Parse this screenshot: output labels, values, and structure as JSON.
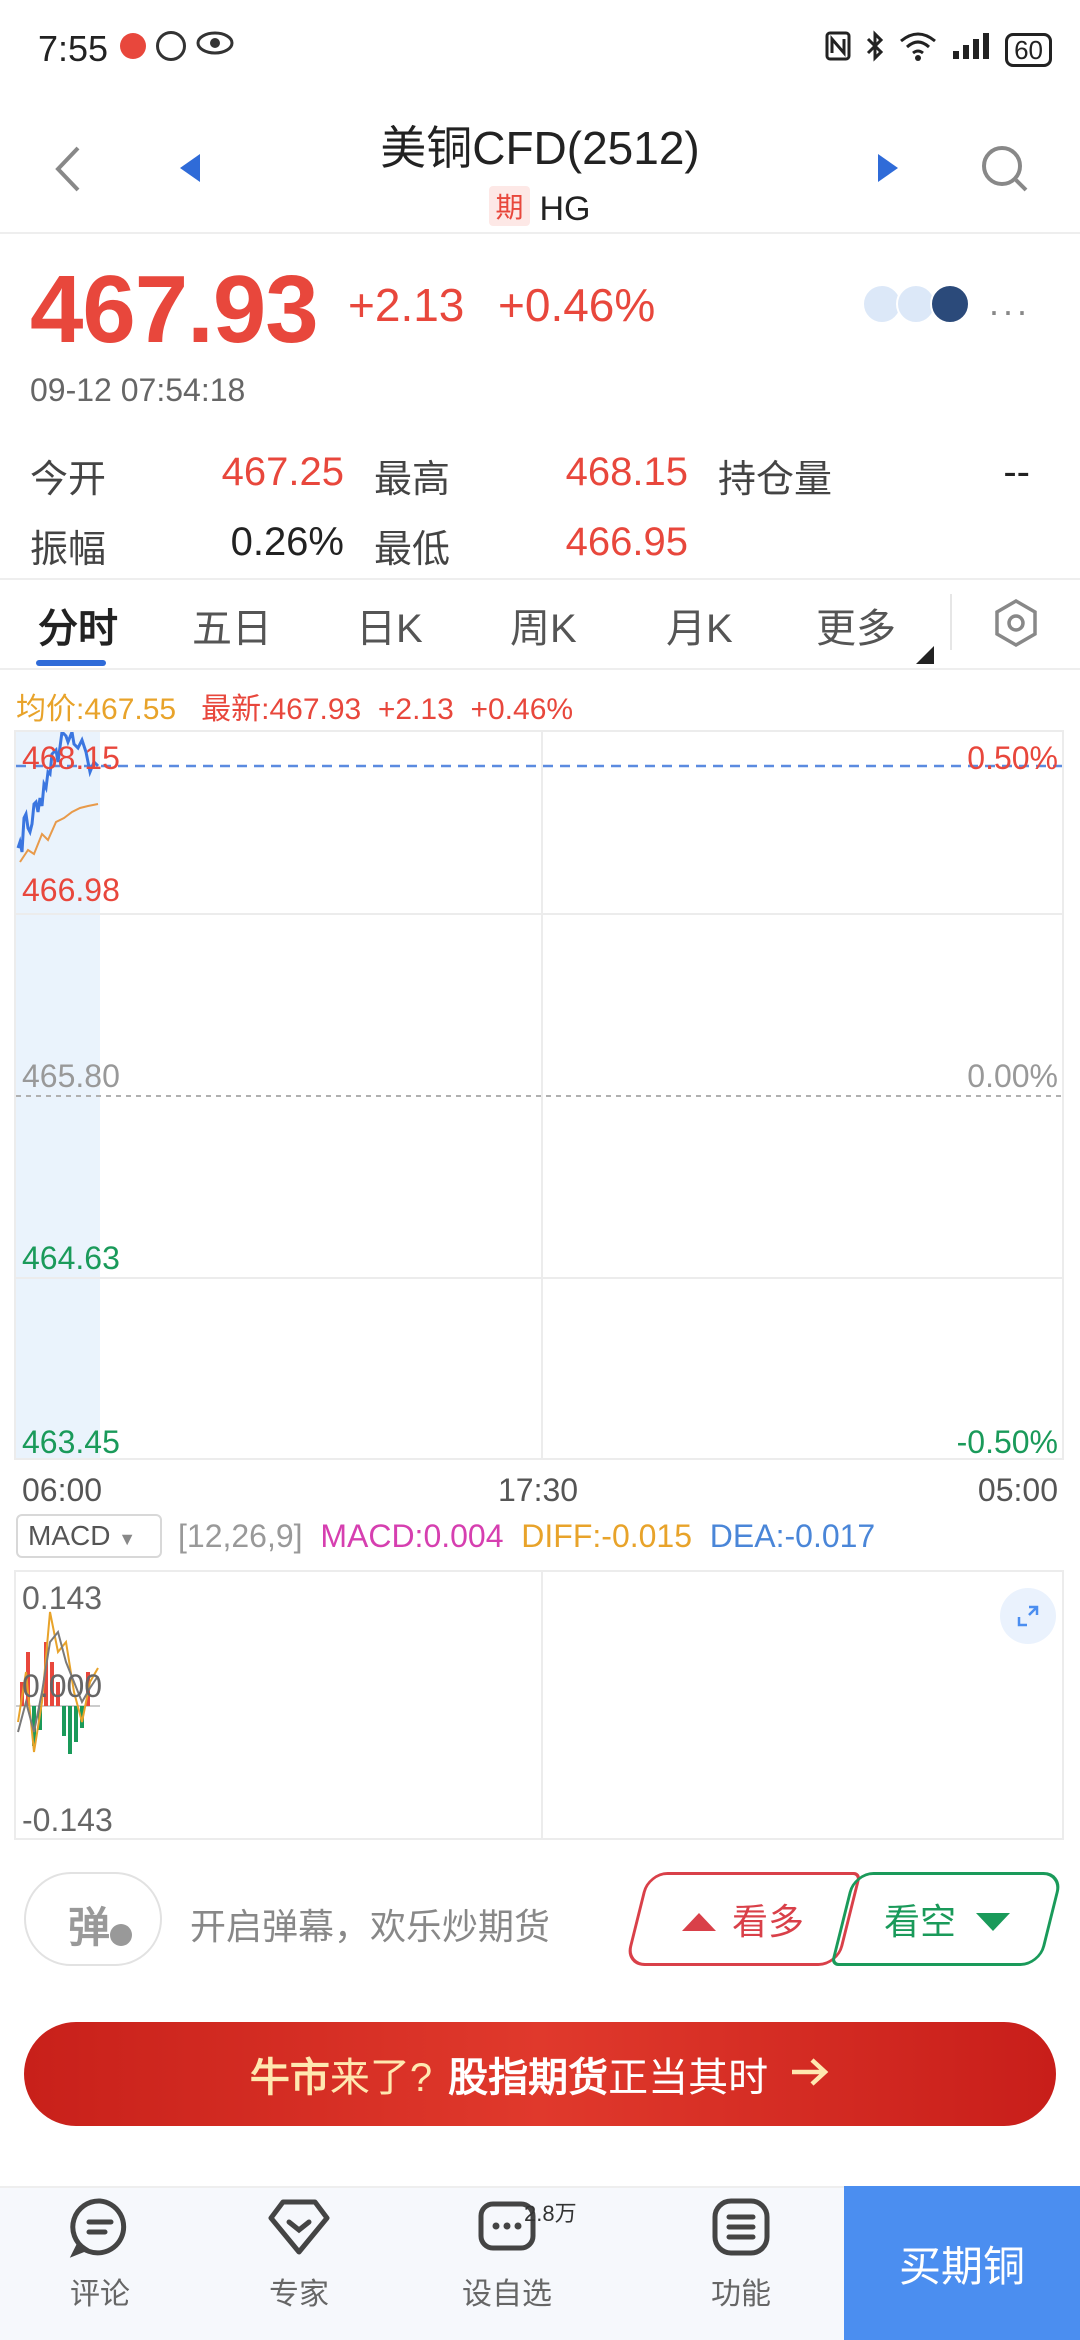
{
  "status": {
    "time": "7:55",
    "battery": "60"
  },
  "header": {
    "title": "美铜CFD(2512)",
    "tag": "期",
    "code": "HG"
  },
  "quote": {
    "price": "467.93",
    "change": "+2.13",
    "change_pct": "+0.46%",
    "time": "09-12 07:54:18",
    "open_label": "今开",
    "open": "467.25",
    "high_label": "最高",
    "high": "468.15",
    "oi_label": "持仓量",
    "oi": "--",
    "amp_label": "振幅",
    "amp": "0.26%",
    "low_label": "最低",
    "low": "466.95"
  },
  "tabs": [
    "分时",
    "五日",
    "日K",
    "周K",
    "月K",
    "更多"
  ],
  "legend": {
    "avg": "均价:467.55",
    "latest": "最新:467.93",
    "chg": "+2.13",
    "pct": "+0.46%"
  },
  "chart": {
    "y_labels": [
      "468.15",
      "466.98",
      "465.80",
      "464.63",
      "463.45"
    ],
    "pct_labels": [
      "0.50%",
      "0.00%",
      "-0.50%"
    ],
    "x_labels": [
      "06:00",
      "17:30",
      "05:00"
    ]
  },
  "macd": {
    "selector": "MACD",
    "params": "[12,26,9]",
    "macd": "MACD:0.004",
    "diff": "DIFF:-0.015",
    "dea": "DEA:-0.017",
    "y_labels": [
      "0.143",
      "0.000",
      "-0.143"
    ]
  },
  "danmu": {
    "button": "弹",
    "text": "开启弹幕，欢乐炒期货",
    "bull": "看多",
    "bear": "看空"
  },
  "banner": {
    "p1": "牛市",
    "p2": "来了?",
    "p3": "股指期货",
    "p4": "正当其时"
  },
  "nav": {
    "comment": "评论",
    "expert": "专家",
    "watch": "设自选",
    "watch_badge": "2.8万",
    "func": "功能",
    "buy": "买期铜"
  },
  "colors": {
    "up": "#e8473c",
    "down": "#1a9a5a",
    "accent": "#2f6bd8",
    "buy": "#4b8ef0"
  }
}
